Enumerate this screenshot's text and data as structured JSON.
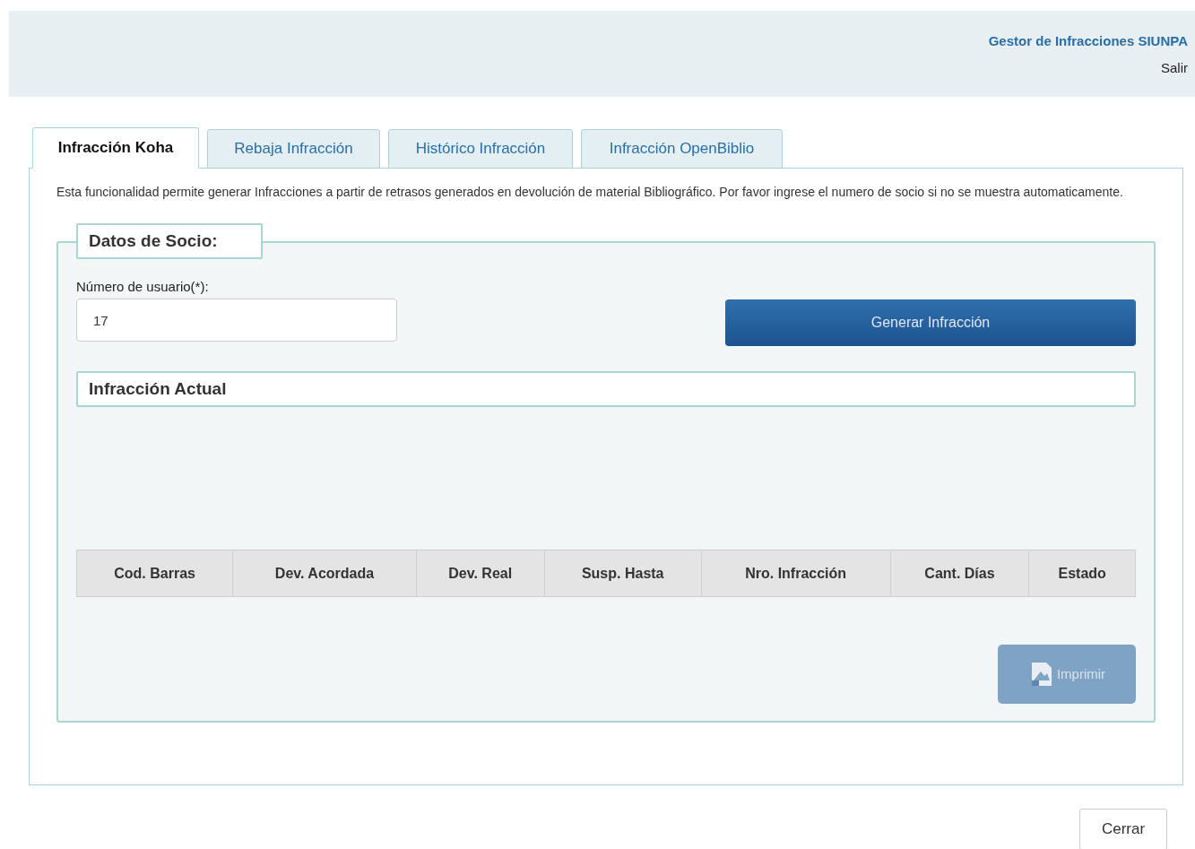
{
  "header": {
    "title": "Gestor de Infracciones SIUNPA",
    "logout": "Salir"
  },
  "tabs": [
    {
      "label": "Infracción Koha",
      "selected": true
    },
    {
      "label": "Rebaja Infracción",
      "selected": false
    },
    {
      "label": "Histórico Infracción",
      "selected": false
    },
    {
      "label": "Infracción OpenBiblio",
      "selected": false
    }
  ],
  "description": "Esta funcionalidad permite generar Infracciones a partir de retrasos generados en devolución de material Bibliográfico. Por favor ingrese el numero de socio si no se muestra automaticamente.",
  "member_section": {
    "legend": "Datos de Socio:",
    "field_label": "Número de usuario(*):",
    "field_value": "17",
    "generate_button": "Generar Infracción",
    "current_title": "Infracción Actual",
    "table": {
      "columns": [
        "Cod. Barras",
        "Dev. Acordada",
        "Dev. Real",
        "Susp. Hasta",
        "Nro. Infracción",
        "Cant. Días",
        "Estado"
      ]
    },
    "print_button": {
      "label": "Imprimir",
      "disabled": true
    }
  },
  "close_button": "Cerrar"
}
